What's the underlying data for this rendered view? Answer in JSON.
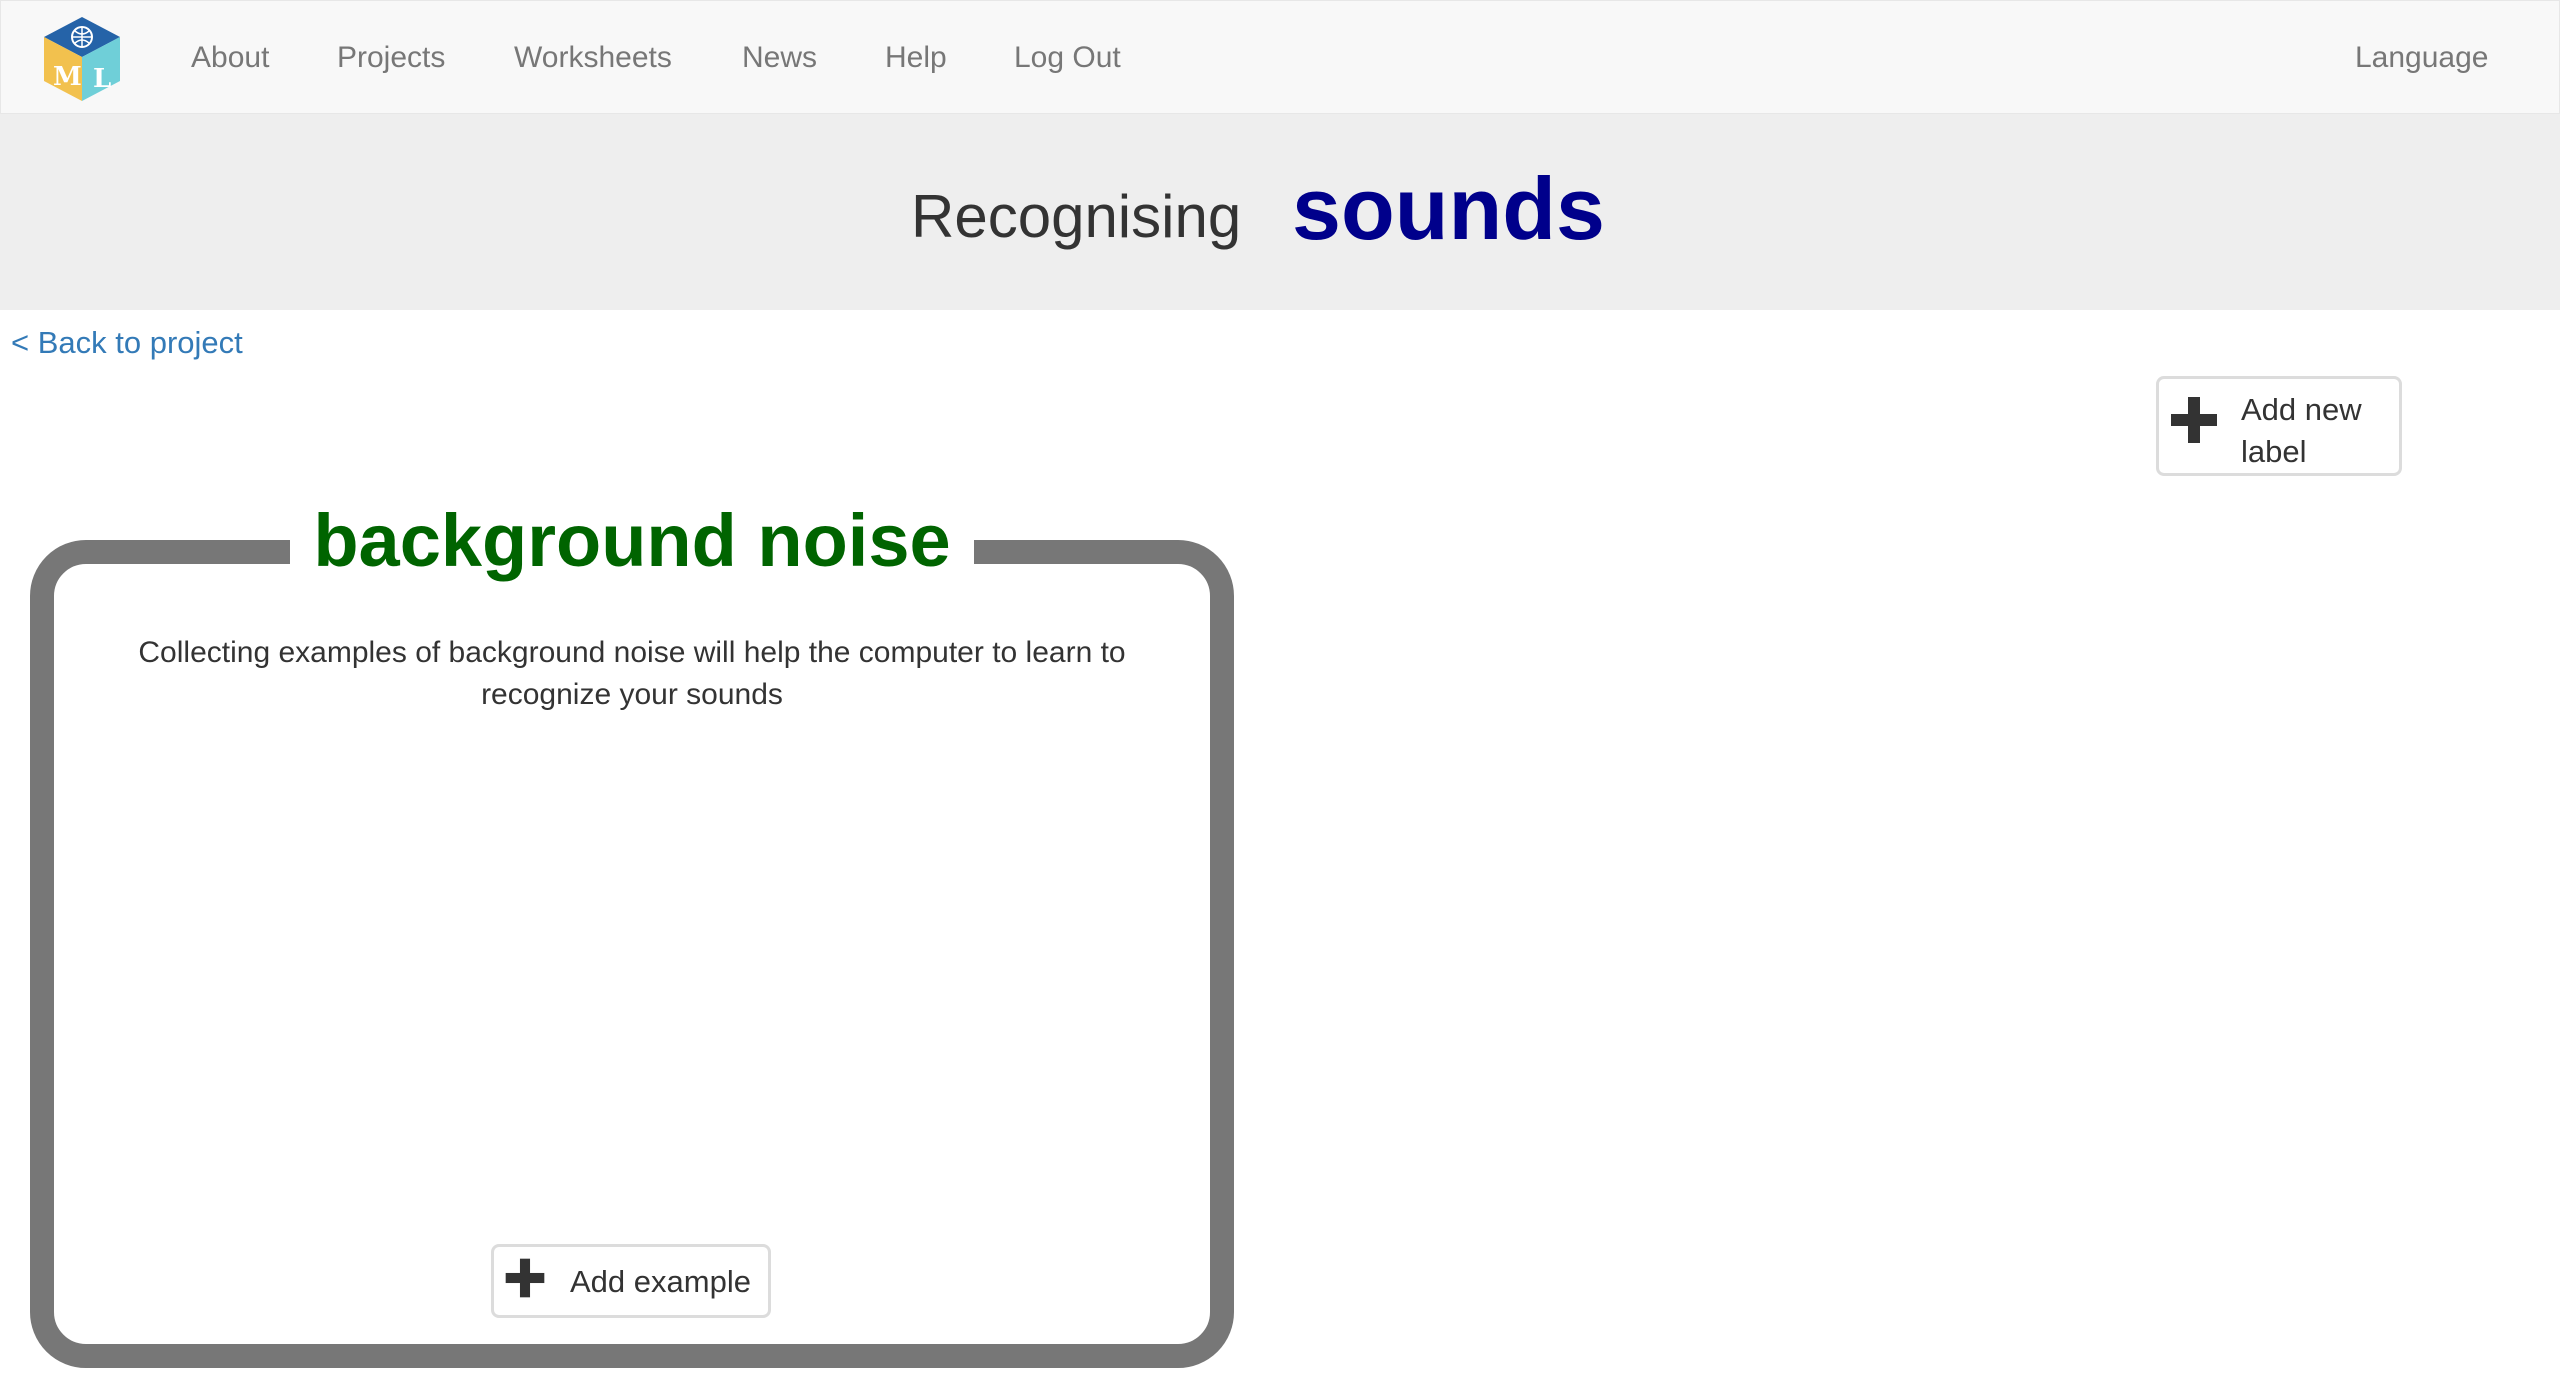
{
  "nav": {
    "logo_alt": "ML",
    "items": [
      {
        "label": "About"
      },
      {
        "label": "Projects"
      },
      {
        "label": "Worksheets"
      },
      {
        "label": "News"
      },
      {
        "label": "Help"
      },
      {
        "label": "Log Out"
      }
    ],
    "language": "Language"
  },
  "banner": {
    "title": "Recognising",
    "project_type": "sounds"
  },
  "back_link": "< Back to project",
  "add_label_button": "Add new label",
  "label_card": {
    "title": "background noise",
    "description": "Collecting examples of background noise will help the computer to learn to recognize your sounds",
    "add_example_button": "Add example"
  },
  "colors": {
    "project_type": "#00008b",
    "label_title": "#006400",
    "link": "#337ab7",
    "card_border": "#777777",
    "banner_bg": "#eeeeee",
    "navbar_bg": "#f8f8f8"
  },
  "icons": {
    "logo": "ml-cube-logo",
    "add": "plus-icon"
  }
}
